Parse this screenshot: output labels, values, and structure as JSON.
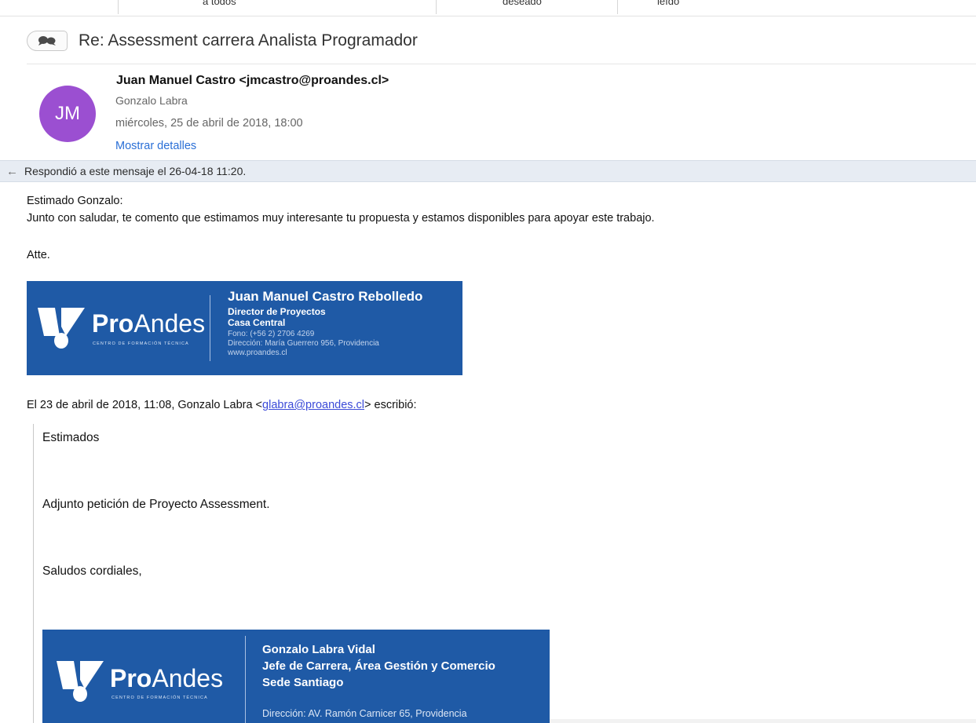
{
  "toolbar": {
    "labels": [
      "a todos",
      "deseado",
      "leído"
    ]
  },
  "message": {
    "subject": "Re: Assessment carrera Analista Programador",
    "from": "Juan Manuel Castro <jmcastro@proandes.cl>",
    "to": "Gonzalo Labra",
    "date": "miércoles, 25 de abril de 2018, 18:00",
    "details_label": "Mostrar detalles",
    "avatar_initials": "JM",
    "avatar_color": "#9b4fd1",
    "replied_notice": "Respondió a este mensaje el 26-04-18 11:20."
  },
  "body": {
    "greeting": "Estimado Gonzalo:",
    "line1": "Junto con saludar, te comento que estimamos muy interesante tu propuesta y estamos disponibles para apoyar este trabajo.",
    "closing": "Atte."
  },
  "signature1": {
    "brand_bold": "Pro",
    "brand_rest": "Andes",
    "tagline": "CENTRO DE FORMACIÓN TÉCNICA",
    "name": "Juan Manuel Castro Rebolledo",
    "role": "Director de Proyectos",
    "office": "Casa Central",
    "phone": "Fono: (+56 2) 2706 4269",
    "address": "Dirección: María Guerrero 956, Providencia",
    "web": "www.proandes.cl",
    "bg_color": "#1f5aa6"
  },
  "quote_header": {
    "prefix": "El 23 de abril de 2018, 11:08, Gonzalo Labra <",
    "email": "glabra@proandes.cl",
    "suffix": "> escribió:"
  },
  "quoted": {
    "line1": "Estimados",
    "line2": "Adjunto petición de Proyecto Assessment.",
    "line3": "Saludos cordiales,"
  },
  "signature2": {
    "brand_bold": "Pro",
    "brand_rest": "Andes",
    "tagline": "CENTRO DE FORMACIÓN TÉCNICA",
    "name": "Gonzalo Labra Vidal",
    "role": "Jefe de Carrera, Área Gestión y Comercio",
    "office": "Sede Santiago",
    "address": "Dirección: AV. Ramón Carnicer 65, Providencia"
  }
}
